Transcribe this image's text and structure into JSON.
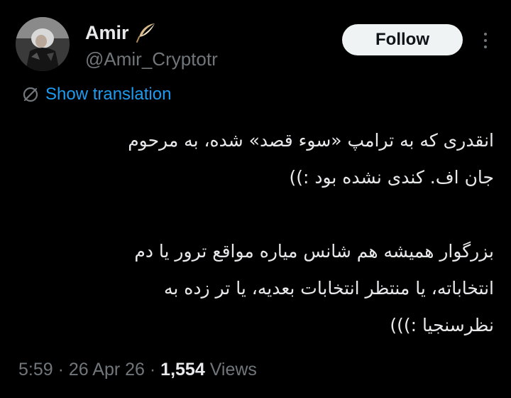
{
  "author": {
    "display_name": "Amir",
    "handle": "@Amir_Cryptotr",
    "name_emoji": "feather-icon"
  },
  "actions": {
    "follow_label": "Follow",
    "more_icon": "more-options-icon"
  },
  "translation": {
    "label": "Show translation",
    "icon": "globe-icon"
  },
  "tweet": {
    "paragraphs": [
      {
        "lines": [
          "انقدری که به ترامپ «سوء قصد» شده، به مرحوم",
          "جان اف. کندی نشده بود :))"
        ]
      },
      {
        "lines": [
          "بزرگوار همیشه هم شانس میاره مواقع ترور یا دم",
          "انتخاباته، یا منتظر انتخابات بعدیه، یا تر زده به",
          "نظرسنجیا :)))"
        ]
      }
    ]
  },
  "meta": {
    "time": "5:59",
    "separator": "·",
    "date": "26 Apr 26",
    "views_count": "1,554",
    "views_label": "Views"
  },
  "colors": {
    "background": "#000000",
    "primary_text": "#e7e9ea",
    "secondary_text": "#71767b",
    "link": "#1d9bf0",
    "button_bg": "#eff3f4",
    "button_text": "#0f1419"
  }
}
